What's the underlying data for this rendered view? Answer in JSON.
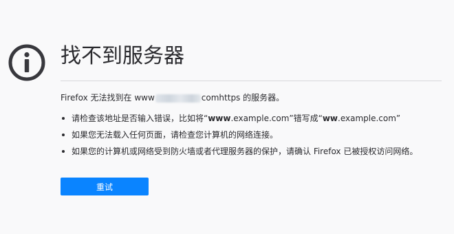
{
  "page": {
    "title": "找不到服务器",
    "icon": "info-icon",
    "description": {
      "prefix": "Firefox 无法找到在 www",
      "suffix": "comhttps 的服务器。"
    },
    "tips": [
      {
        "parts": [
          {
            "text": "请检查该地址是否输入错误，比如将“",
            "bold": false
          },
          {
            "text": "www",
            "bold": true
          },
          {
            "text": ".example.com”错写成“",
            "bold": false
          },
          {
            "text": "ww",
            "bold": true
          },
          {
            "text": ".example.com”",
            "bold": false
          }
        ]
      },
      {
        "parts": [
          {
            "text": "如果您无法载入任何页面，请检查您计算机的网络连接。",
            "bold": false
          }
        ]
      },
      {
        "parts": [
          {
            "text": "如果您的计算机或网络受到防火墙或者代理服务器的保护，请确认 Firefox 已被授权访问网络。",
            "bold": false
          }
        ]
      }
    ],
    "retry_label": "重试"
  },
  "colors": {
    "background": "#f9f9fa",
    "accent": "#0a84ff",
    "text": "#2a2a2e",
    "icon": "#38383d"
  }
}
